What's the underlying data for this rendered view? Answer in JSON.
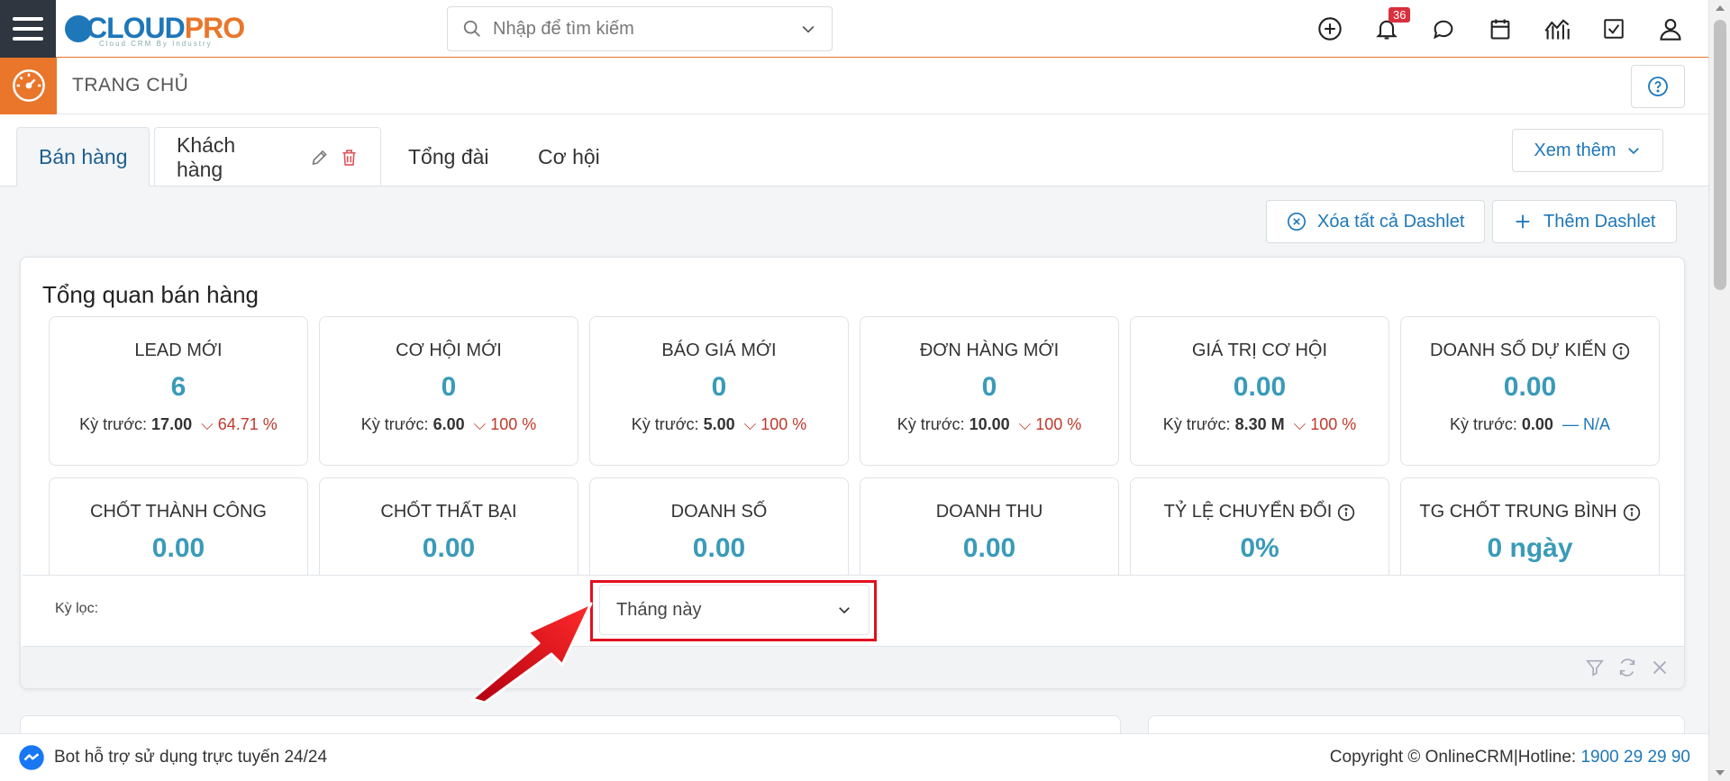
{
  "brand": {
    "logo_part1": "CLOUD",
    "logo_part2": "PRO",
    "tagline": "Cloud CRM By Industry"
  },
  "search": {
    "placeholder": "Nhập để tìm kiếm"
  },
  "notifications": {
    "count": "36"
  },
  "header": {
    "title": "TRANG CHỦ"
  },
  "tabs": [
    {
      "label": "Bán hàng"
    },
    {
      "label": "Khách hàng"
    },
    {
      "label": "Tổng đài"
    },
    {
      "label": "Cơ hội"
    }
  ],
  "more_button": "Xem thêm",
  "actions": {
    "clear_all": "Xóa tất cả Dashlet",
    "add": "Thêm Dashlet"
  },
  "dashlet": {
    "title": "Tổng quan bán hàng",
    "prev_label": "Kỳ trước:",
    "kpis_row1": [
      {
        "label": "LEAD MỚI",
        "value": "6",
        "prev": "17.00",
        "change": "64.71 %"
      },
      {
        "label": "CƠ HỘI MỚI",
        "value": "0",
        "prev": "6.00",
        "change": "100 %"
      },
      {
        "label": "BÁO GIÁ MỚI",
        "value": "0",
        "prev": "5.00",
        "change": "100 %"
      },
      {
        "label": "ĐƠN HÀNG MỚI",
        "value": "0",
        "prev": "10.00",
        "change": "100 %"
      },
      {
        "label": "GIÁ TRỊ CƠ HỘI",
        "value": "0.00",
        "prev": "8.30 M",
        "change": "100 %"
      },
      {
        "label": "DOANH SỐ DỰ KIẾN",
        "value": "0.00",
        "prev": "0.00",
        "change": "N/A"
      }
    ],
    "kpis_row2": [
      {
        "label": "CHỐT THÀNH CÔNG",
        "value": "0.00"
      },
      {
        "label": "CHỐT THẤT BẠI",
        "value": "0.00"
      },
      {
        "label": "DOANH SỐ",
        "value": "0.00"
      },
      {
        "label": "DOANH THU",
        "value": "0.00"
      },
      {
        "label": "TỶ LỆ CHUYỂN ĐỔI",
        "value": "0%"
      },
      {
        "label": "TG CHỐT TRUNG BÌNH",
        "value": "0 ngày"
      }
    ],
    "filter_label": "Kỳ lọc:",
    "filter_value": "Tháng này"
  },
  "footer": {
    "bot_text": "Bot hỗ trợ sử dụng trực tuyến 24/24",
    "copyright": "Copyright © OnlineCRM|Hotline: ",
    "hotline": "1900 29 29 90"
  },
  "colors": {
    "accent": "#e9762b",
    "primary": "#1d77b9",
    "value": "#3a9bb8",
    "down": "#c0392b",
    "highlight": "#e0101f"
  }
}
